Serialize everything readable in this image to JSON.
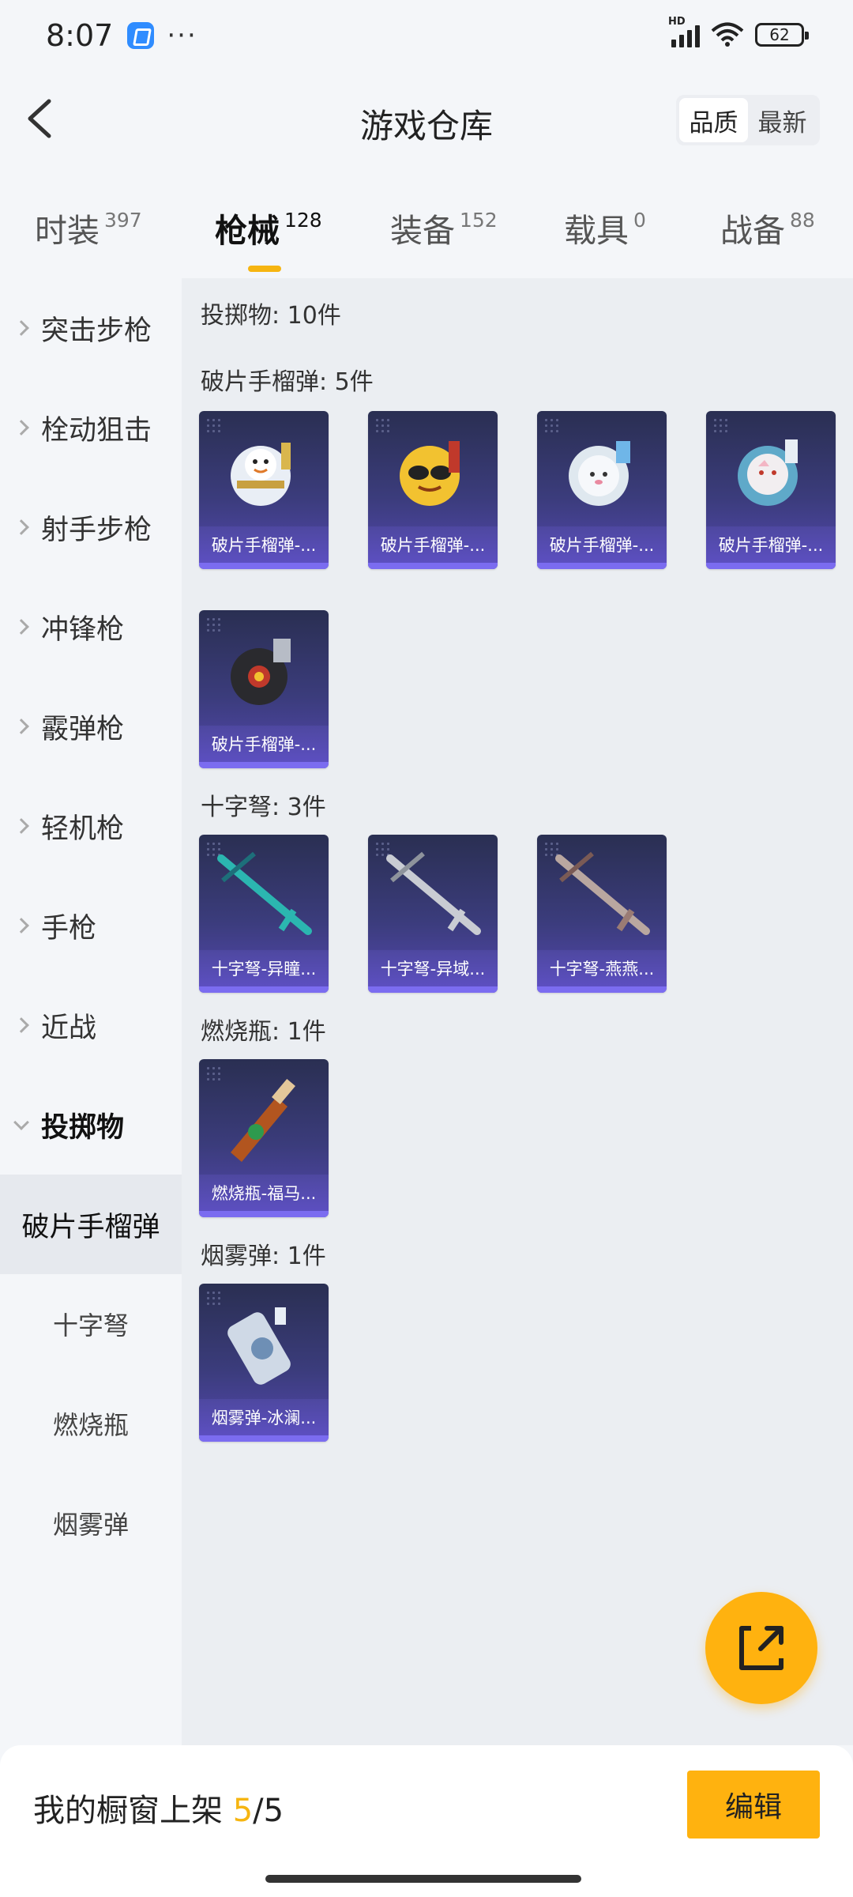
{
  "status_bar": {
    "time": "8:07",
    "dots": "···",
    "battery": "62",
    "network": "HD"
  },
  "header": {
    "title": "游戏仓库",
    "sort_options": [
      {
        "label": "品质",
        "active": true
      },
      {
        "label": "最新",
        "active": false
      }
    ]
  },
  "tabs": [
    {
      "label": "时装",
      "count": "397",
      "active": false
    },
    {
      "label": "枪械",
      "count": "128",
      "active": true
    },
    {
      "label": "装备",
      "count": "152",
      "active": false
    },
    {
      "label": "载具",
      "count": "0",
      "active": false
    },
    {
      "label": "战备",
      "count": "88",
      "active": false
    }
  ],
  "sidebar": {
    "categories": [
      "突击步枪",
      "栓动狙击",
      "射手步枪",
      "冲锋枪",
      "霰弹枪",
      "轻机枪",
      "手枪",
      "近战",
      "投掷物"
    ],
    "subcategories": [
      {
        "label": "破片手榴弹",
        "active": true
      },
      {
        "label": "十字弩",
        "active": false
      },
      {
        "label": "燃烧瓶",
        "active": false
      },
      {
        "label": "烟雾弹",
        "active": false
      }
    ]
  },
  "content": {
    "summary": "投掷物: 10件",
    "sections": [
      {
        "title": "破片手榴弹: 5件",
        "items": [
          "破片手榴弹-...",
          "破片手榴弹-...",
          "破片手榴弹-...",
          "破片手榴弹-...",
          "破片手榴弹-..."
        ]
      },
      {
        "title": "十字弩: 3件",
        "items": [
          "十字弩-异瞳...",
          "十字弩-异域...",
          "十字弩-燕燕..."
        ]
      },
      {
        "title": "燃烧瓶: 1件",
        "items": [
          "燃烧瓶-福马..."
        ]
      },
      {
        "title": "烟雾弹: 1件",
        "items": [
          "烟雾弹-冰澜..."
        ]
      }
    ]
  },
  "bottom": {
    "prefix": "我的橱窗上架 ",
    "current": "5",
    "separator": "/",
    "total": "5",
    "edit_label": "编辑"
  },
  "colors": {
    "accent": "#ffb20f",
    "card_bg": "#3b3c7c",
    "card_caption": "#5c4fc0"
  }
}
